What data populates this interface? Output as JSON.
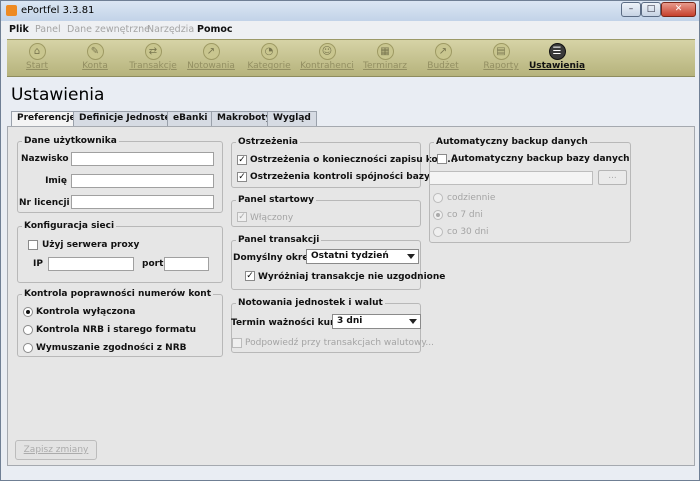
{
  "window": {
    "title": "ePortfel 3.3.81",
    "minimize": "–",
    "maximize": "□",
    "close": "✕"
  },
  "menu": [
    "Plik",
    "Panel",
    "Dane zewnętrzne",
    "Narzędzia",
    "Pomoc"
  ],
  "toolbar": [
    {
      "label": "Start",
      "icon": "home-icon",
      "glyph": "⌂"
    },
    {
      "label": "Konta",
      "icon": "accounts-icon",
      "glyph": "✎"
    },
    {
      "label": "Transakcje",
      "icon": "transactions-icon",
      "glyph": "⇄"
    },
    {
      "label": "Notowania",
      "icon": "quotes-icon",
      "glyph": "↗"
    },
    {
      "label": "Kategorie",
      "icon": "categories-icon",
      "glyph": "◔"
    },
    {
      "label": "Kontrahenci",
      "icon": "contractors-icon",
      "glyph": "☺"
    },
    {
      "label": "Terminarz",
      "icon": "calendar-icon",
      "glyph": "▦"
    },
    {
      "label": "Budżet",
      "icon": "budget-icon",
      "glyph": "↗"
    },
    {
      "label": "Raporty",
      "icon": "reports-icon",
      "glyph": "▤"
    },
    {
      "label": "Ustawienia",
      "icon": "settings-icon",
      "glyph": "☰"
    }
  ],
  "page": {
    "heading": "Ustawienia"
  },
  "tabs": [
    "Preferencje",
    "Definicje Jednostek",
    "eBanki",
    "Makroboty",
    "Wygląd"
  ],
  "user": {
    "title": "Dane użytkownika",
    "fields": [
      {
        "label": "Nazwisko",
        "value": ""
      },
      {
        "label": "Imię",
        "value": ""
      },
      {
        "label": "Nr licencji",
        "value": ""
      }
    ]
  },
  "network": {
    "title": "Konfiguracja sieci",
    "proxy_label": "Użyj serwera proxy",
    "proxy_checked": false,
    "ip_label": "IP",
    "ip_value": "",
    "port_label": "port",
    "port_value": ""
  },
  "account_check": {
    "title": "Kontrola poprawności numerów kont",
    "options": [
      "Kontrola wyłączona",
      "Kontrola NRB i starego formatu",
      "Wymuszanie zgodności z NRB"
    ],
    "selected": 0
  },
  "warnings": {
    "title": "Ostrzeżenia",
    "items": [
      {
        "label": "Ostrzeżenia o konieczności zapisu kopi...",
        "checked": true
      },
      {
        "label": "Ostrzeżenia kontroli spójności bazy",
        "checked": true
      }
    ]
  },
  "start_panel": {
    "title": "Panel startowy",
    "enabled_label": "Włączony",
    "enabled_checked": true
  },
  "transactions_panel": {
    "title": "Panel transakcji",
    "period_label": "Domyślny okres",
    "period_value": "Ostatni tydzień",
    "highlight_label": "Wyróżniaj transakcje nie uzgodnione",
    "highlight_checked": true
  },
  "quotes": {
    "title": "Notowania jednostek i walut",
    "validity_label": "Termin ważności kur...",
    "validity_value": "3 dni",
    "hint_label": "Podpowiedź przy transakcjach walutowy...",
    "hint_checked": false
  },
  "backup": {
    "title": "Automatyczny backup danych",
    "checkbox_label": "Automatyczny backup bazy danych",
    "checked": false,
    "path_value": "",
    "browse_label": "...",
    "options": [
      "codziennie",
      "co 7 dni",
      "co 30 dni"
    ],
    "selected": 1
  },
  "save_button": "Zapisz zmiany"
}
